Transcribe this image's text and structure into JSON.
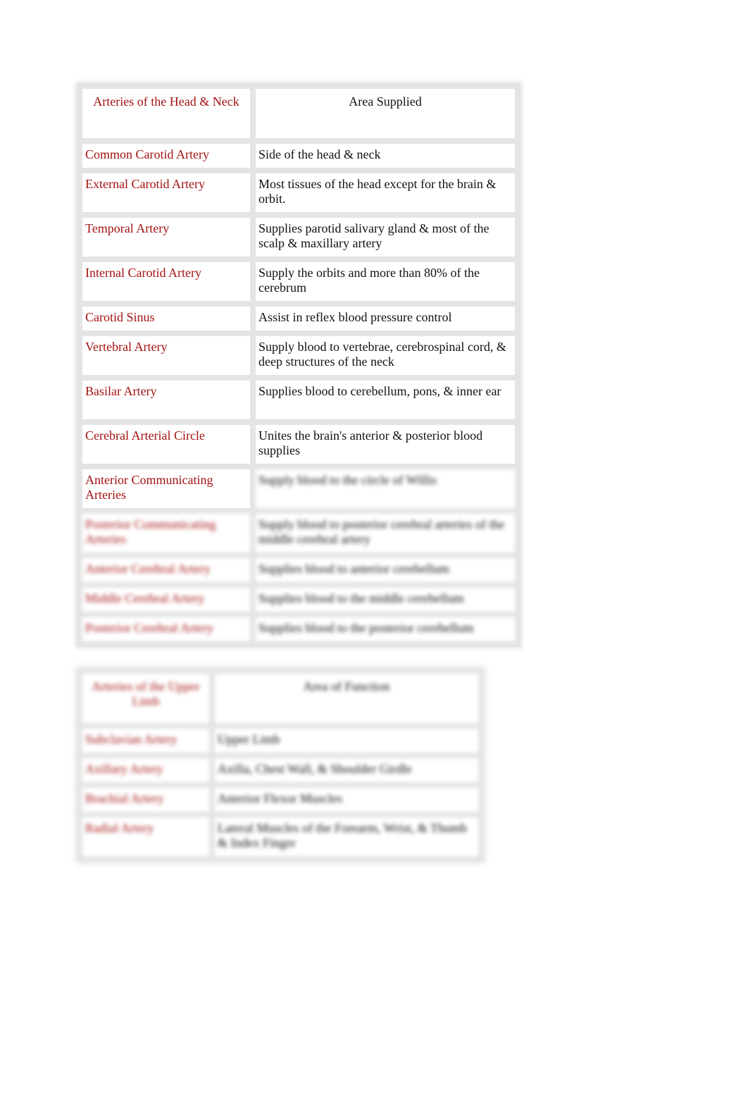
{
  "table1": {
    "headers": [
      "Arteries of the Head & Neck",
      "Area Supplied"
    ],
    "rows": [
      {
        "artery": "Common Carotid Artery",
        "area": "Side of the head & neck"
      },
      {
        "artery": "External Carotid Artery",
        "area": "Most tissues of the head except for the brain & orbit."
      },
      {
        "artery": "Temporal Artery",
        "area": "Supplies parotid salivary gland & most of the scalp & maxillary artery"
      },
      {
        "artery": "Internal Carotid Artery",
        "area": "Supply the orbits and more than 80% of the cerebrum"
      },
      {
        "artery": "Carotid Sinus",
        "area": "Assist in reflex blood pressure control"
      },
      {
        "artery": "Vertebral Artery",
        "area": "Supply blood to vertebrae, cerebrospinal cord, & deep structures of the neck"
      },
      {
        "artery": "Basilar Artery",
        "area": "Supplies blood to cerebellum, pons, & inner ear"
      },
      {
        "artery": "Cerebral Arterial Circle",
        "area": "Unites the brain's anterior & posterior blood supplies"
      },
      {
        "artery": "Anterior Communicating Arteries",
        "area": "Supply blood to the circle of Willis"
      },
      {
        "artery": "Posterior Communicating Arteries",
        "area": "Supply blood to posterior cerebral arteries of the middle cerebral artery"
      },
      {
        "artery": "Anterior Cerebral Artery",
        "area": "Supplies blood to anterior cerebellum"
      },
      {
        "artery": "Middle Cerebral Artery",
        "area": "Supplies blood to the middle cerebellum"
      },
      {
        "artery": "Posterior Cerebral Artery",
        "area": "Supplies blood to the posterior cerebellum"
      }
    ]
  },
  "table2": {
    "headers": [
      "Arteries of the Upper Limb",
      "Area of Function"
    ],
    "rows": [
      {
        "artery": "Subclavian Artery",
        "area": "Upper Limb"
      },
      {
        "artery": "Axillary Artery",
        "area": "Axilla, Chest Wall, & Shoulder Girdle"
      },
      {
        "artery": "Brachial Artery",
        "area": "Anterior Flexor Muscles"
      },
      {
        "artery": "Radial Artery",
        "area": "Lateral Muscles of the Forearm, Wrist, & Thumb & Index Finger"
      }
    ]
  },
  "colors": {
    "artery_text": "#a31212",
    "body_text": "#111111"
  }
}
